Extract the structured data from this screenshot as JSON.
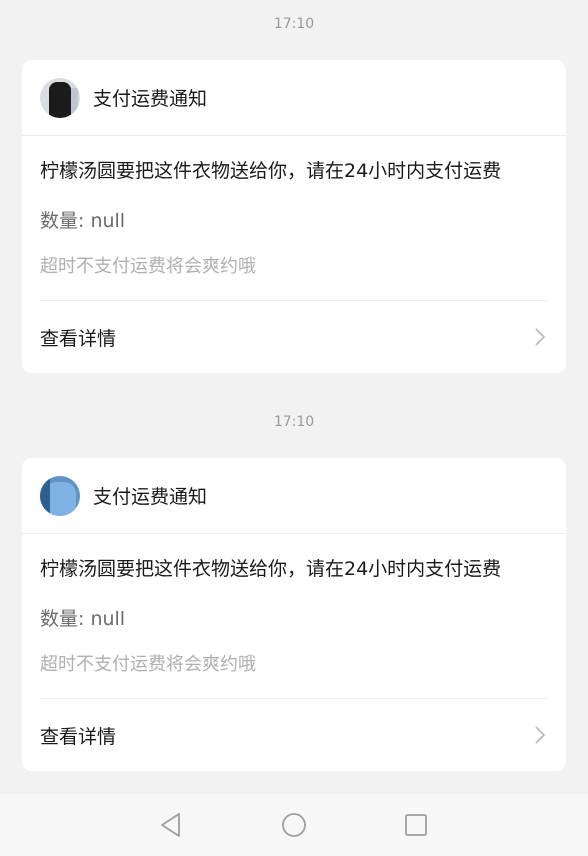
{
  "messages": [
    {
      "time": "17:10",
      "avatar": "avatar-dark-clothing",
      "title": "支付运费通知",
      "text": "柠檬汤圆要把这件衣物送给你，请在24小时内支付运费",
      "quantity": "数量: null",
      "hint": "超时不支付运费将会爽约哦",
      "action": "查看详情"
    },
    {
      "time": "17:10",
      "avatar": "avatar-blue-clothing",
      "title": "支付运费通知",
      "text": "柠檬汤圆要把这件衣物送给你，请在24小时内支付运费",
      "quantity": "数量: null",
      "hint": "超时不支付运费将会爽约哦",
      "action": "查看详情"
    }
  ],
  "navbar": {
    "back_icon": "triangle-back-icon",
    "home_icon": "circle-home-icon",
    "recent_icon": "square-recent-icon"
  },
  "colors": {
    "background": "#f2f2f2",
    "card": "#ffffff",
    "muted": "#9a9a9a",
    "hint": "#b0b0b0"
  }
}
